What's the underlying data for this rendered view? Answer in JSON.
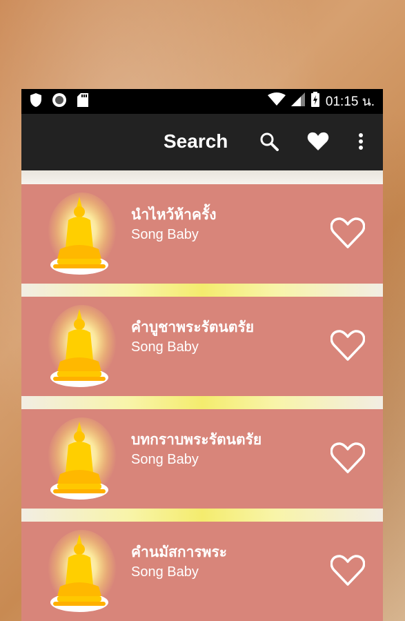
{
  "status_bar": {
    "time": "01:15 น.",
    "icons": [
      "shield-icon",
      "record-icon",
      "sd-card-icon",
      "wifi-icon",
      "signal-icon",
      "battery-charging-icon"
    ]
  },
  "toolbar": {
    "title": "Search",
    "icons": [
      "search-icon",
      "heart-icon",
      "more-vert-icon"
    ]
  },
  "songs": [
    {
      "title": "นำไหว้ห้าครั้ง",
      "artist": "Song Baby"
    },
    {
      "title": "คำบูชาพระรัตนตรัย",
      "artist": "Song Baby"
    },
    {
      "title": "บทกราบพระรัตนตรัย",
      "artist": "Song Baby"
    },
    {
      "title": "คำนมัสการพระ",
      "artist": "Song Baby"
    }
  ],
  "colors": {
    "item_background": "#d8857a",
    "toolbar": "#222222",
    "status_bar": "#000000",
    "text": "#ffffff"
  }
}
